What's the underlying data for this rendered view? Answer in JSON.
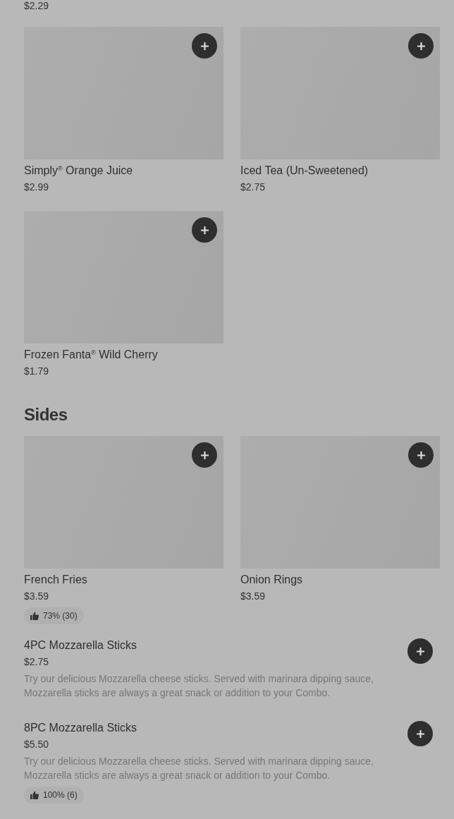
{
  "top_price": "$2.29",
  "drinks": [
    {
      "name": "Simply$^{®}$ Orange Juice",
      "price": "$2.99"
    },
    {
      "name": "Iced Tea (Un-Sweetened)",
      "price": "$2.75"
    },
    {
      "name": "Frozen Fanta$^{®}$ Wild Cherry",
      "price": "$1.79"
    }
  ],
  "sections": [
    {
      "title": "Sides",
      "grid": [
        {
          "name": "French Fries",
          "price": "$3.59",
          "rating": "73% (30)"
        },
        {
          "name": "Onion Rings",
          "price": "$3.59"
        }
      ],
      "list": [
        {
          "name": "4PC Mozzarella Sticks",
          "price": "$2.75",
          "description": "Try our delicious Mozzarella cheese sticks. Served with marinara dipping sauce, Mozzarella sticks are always a great snack or addition to your Combo."
        },
        {
          "name": "8PC Mozzarella Sticks",
          "price": "$5.50",
          "description": "Try our delicious Mozzarella cheese sticks. Served with marinara dipping sauce, Mozzarella sticks are always a great snack or addition to your Combo.",
          "rating": "100% (6)"
        }
      ]
    }
  ]
}
